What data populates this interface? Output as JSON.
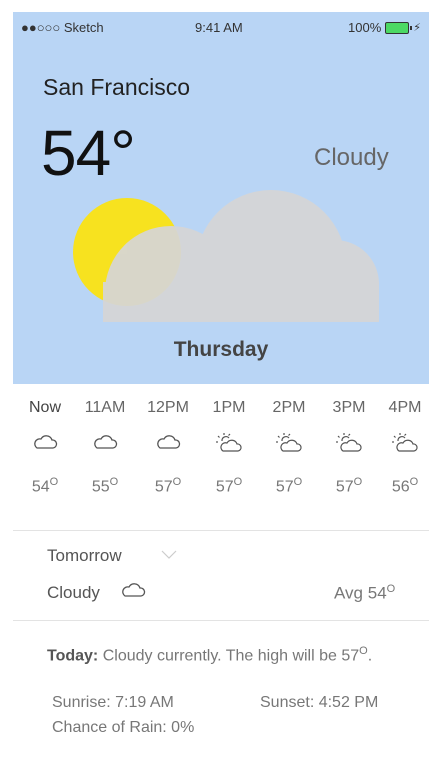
{
  "status_bar": {
    "carrier": "●●○○○ Sketch",
    "time": "9:41 AM",
    "battery": "100%"
  },
  "current": {
    "city": "San Francisco",
    "temperature": "54°",
    "condition": "Cloudy",
    "day": "Thursday"
  },
  "hourly": [
    {
      "label": "Now",
      "temp": "54",
      "icon": "cloud-icon"
    },
    {
      "label": "11AM",
      "temp": "55",
      "icon": "cloud-icon"
    },
    {
      "label": "12PM",
      "temp": "57",
      "icon": "cloud-icon"
    },
    {
      "label": "1PM",
      "temp": "57",
      "icon": "partly-sunny-icon"
    },
    {
      "label": "2PM",
      "temp": "57",
      "icon": "partly-sunny-icon"
    },
    {
      "label": "3PM",
      "temp": "57",
      "icon": "partly-sunny-icon"
    },
    {
      "label": "4PM",
      "temp": "56",
      "icon": "partly-sunny-icon"
    }
  ],
  "degree_symbol": "O",
  "tomorrow": {
    "label": "Tomorrow",
    "condition": "Cloudy",
    "avg_label": "Avg",
    "avg_temp": "54"
  },
  "today": {
    "label": "Today:",
    "text": "Cloudy currently. The high will be 57",
    "suffix": "."
  },
  "details": {
    "sunrise": "Sunrise: 7:19 AM",
    "sunset": "Sunset: 4:52 PM",
    "rain": "Chance of Rain: 0%"
  },
  "colors": {
    "hero_bg": "#b9d5f5",
    "sun": "#f7e21f",
    "cloud": "#d6d6d6"
  }
}
